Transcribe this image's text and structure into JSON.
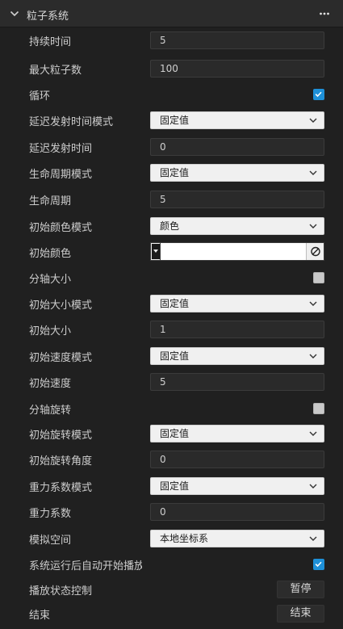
{
  "header": {
    "title": "粒子系统"
  },
  "rows": {
    "duration": {
      "label": "持续时间",
      "value": "5"
    },
    "max_particles": {
      "label": "最大粒子数",
      "value": "100"
    },
    "loop": {
      "label": "循环",
      "checked": true
    },
    "start_delay_mode": {
      "label": "延迟发射时间模式",
      "value": "固定值"
    },
    "start_delay": {
      "label": "延迟发射时间",
      "value": "0"
    },
    "lifetime_mode": {
      "label": "生命周期模式",
      "value": "固定值"
    },
    "lifetime": {
      "label": "生命周期",
      "value": "5"
    },
    "start_color_mode": {
      "label": "初始颜色模式",
      "value": "颜色"
    },
    "start_color": {
      "label": "初始颜色",
      "color": "#ffffff"
    },
    "split_axis_size": {
      "label": "分轴大小",
      "checked": false
    },
    "start_size_mode": {
      "label": "初始大小模式",
      "value": "固定值"
    },
    "start_size": {
      "label": "初始大小",
      "value": "1"
    },
    "start_speed_mode": {
      "label": "初始速度模式",
      "value": "固定值"
    },
    "start_speed": {
      "label": "初始速度",
      "value": "5"
    },
    "split_axis_rotation": {
      "label": "分轴旋转",
      "checked": false
    },
    "start_rotation_mode": {
      "label": "初始旋转模式",
      "value": "固定值"
    },
    "start_rotation": {
      "label": "初始旋转角度",
      "value": "0"
    },
    "gravity_mode": {
      "label": "重力系数模式",
      "value": "固定值"
    },
    "gravity": {
      "label": "重力系数",
      "value": "0"
    },
    "simulation_space": {
      "label": "模拟空间",
      "value": "本地坐标系"
    },
    "play_on_awake": {
      "label": "系统运行后自动开始播放",
      "checked": true
    },
    "playback_control": {
      "label": "播放状态控制",
      "button": "暂停"
    },
    "stop": {
      "label": "结束",
      "button": "结束"
    }
  },
  "colors": {
    "accent": "#1e90d8",
    "background": "#202020"
  }
}
